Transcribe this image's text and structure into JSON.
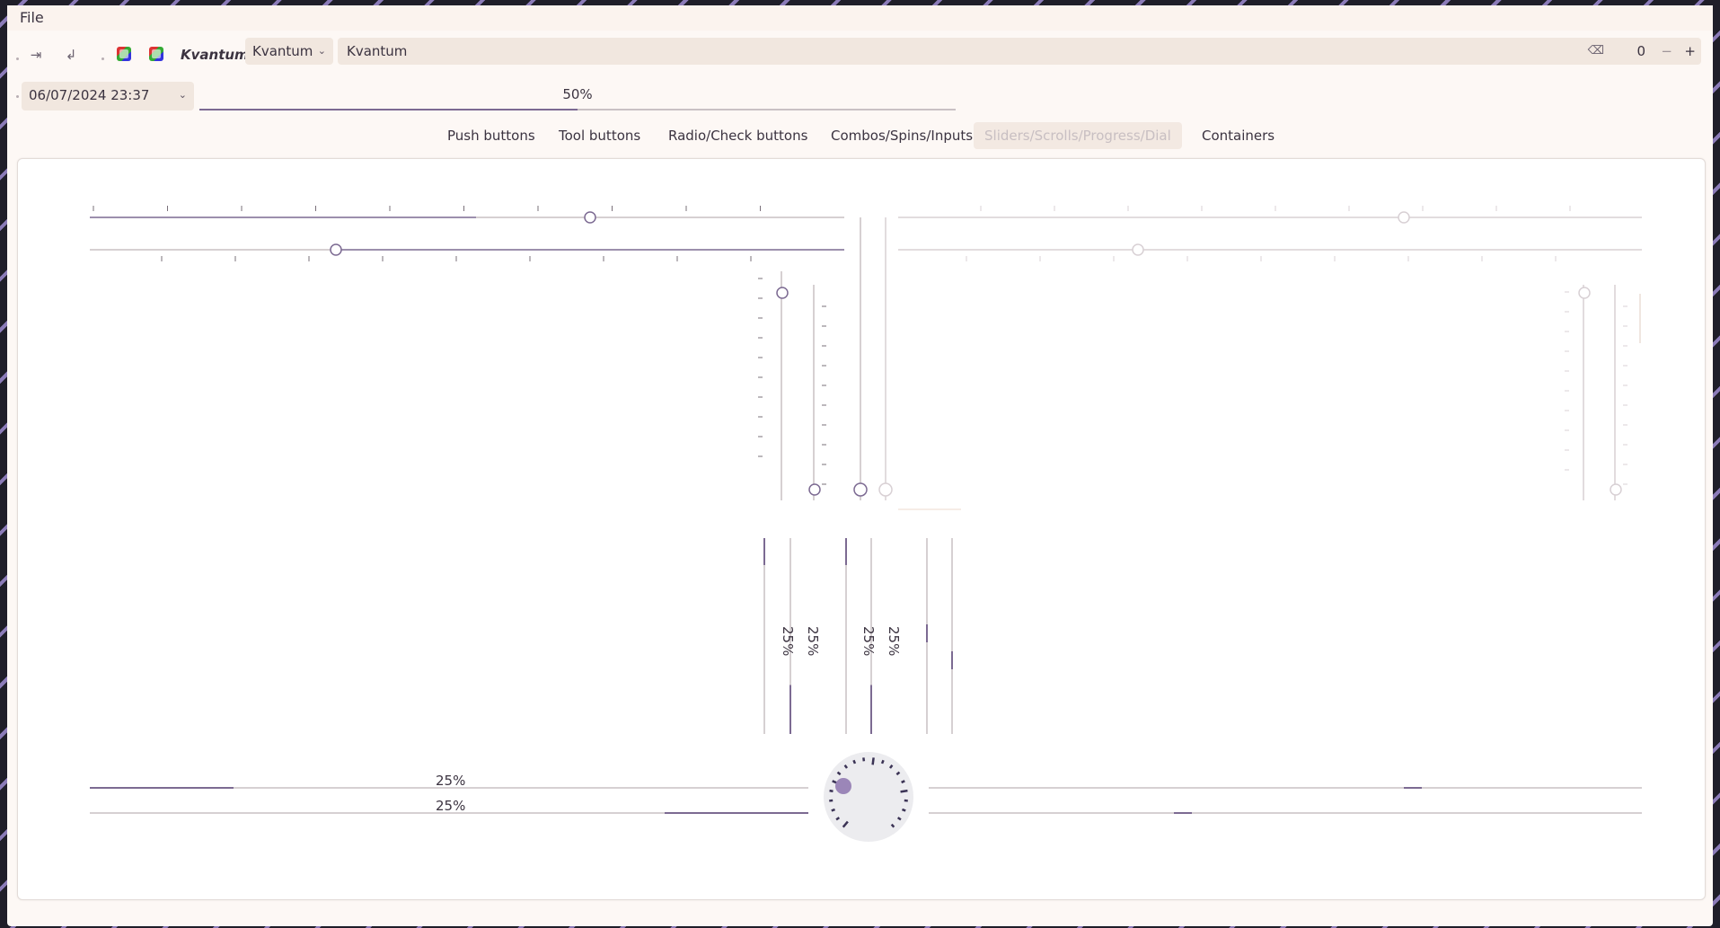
{
  "menubar": {
    "file": "File"
  },
  "toolbar": {
    "style_label": "Kvantum",
    "style_combo": "Kvantum",
    "line_edit": "Kvantum",
    "spin_value": "0",
    "spin_minus": "−",
    "spin_plus": "+"
  },
  "datetime": {
    "value": "06/07/2024 23:37"
  },
  "top_progress": {
    "label": "50%",
    "value": 0.5
  },
  "tabs": [
    {
      "label": "Push buttons",
      "active": false
    },
    {
      "label": "Tool buttons",
      "active": false
    },
    {
      "label": "Radio/Check buttons",
      "active": false
    },
    {
      "label": "Combos/Spins/Inputs",
      "active": false
    },
    {
      "label": "Sliders/Scrolls/Progress/Dial",
      "active": true
    },
    {
      "label": "Containers",
      "active": false
    }
  ],
  "progress": {
    "vertical_labels": [
      "25%",
      "25%",
      "25%",
      "25%"
    ],
    "horizontal_labels": [
      "25%",
      "25%"
    ],
    "value": 0.25
  },
  "colors": {
    "accent": "#7c6a92",
    "disabled": "#d8d0d4",
    "track": "#c9c1c4"
  },
  "icons": [
    "exit-icon",
    "return-icon",
    "kvantum-icon",
    "kvantum-icon-2",
    "chevron-down-icon",
    "clear-icon"
  ]
}
